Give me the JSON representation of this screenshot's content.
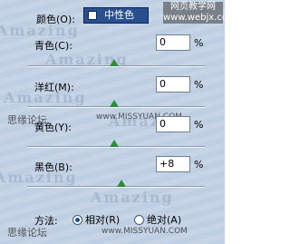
{
  "color_select": {
    "label": "颜色(O):",
    "value": "中性色"
  },
  "sliders": [
    {
      "label": "青色(C):",
      "value": "0",
      "unit": "%",
      "level": 0
    },
    {
      "label": "洋红(M):",
      "value": "0",
      "unit": "%",
      "level": 0
    },
    {
      "label": "黄色(Y):",
      "value": "0",
      "unit": "%",
      "level": 0
    },
    {
      "label": "黑色(B):",
      "value": "+8",
      "unit": "%",
      "level": 8
    }
  ],
  "method": {
    "label": "方法:",
    "options": [
      {
        "label": "相对(R)",
        "checked": true
      },
      {
        "label": "绝对(A)",
        "checked": false
      }
    ]
  },
  "watermarks": {
    "pattern": "Amazing",
    "forum_text": "思缘论坛",
    "site": "www.MISSYUAN.COM",
    "badge_line1": "网页教学网",
    "badge_line2": "www.webjx.com"
  },
  "colors": {
    "panel_bg": "#bfcfe3",
    "dropdown_bg": "#2a4f8f",
    "thumb": "#2e8b3a"
  }
}
